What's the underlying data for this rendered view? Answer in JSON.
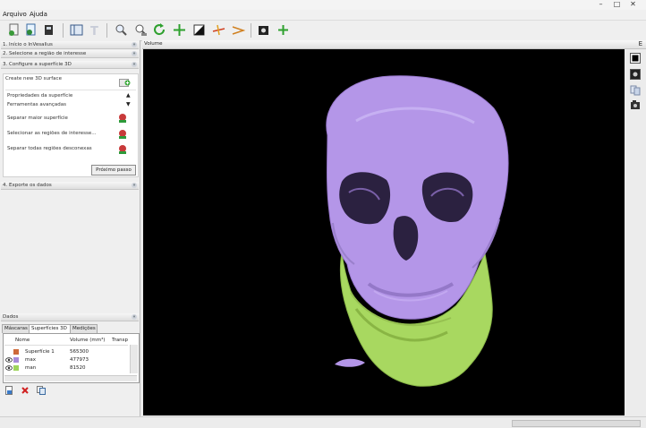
{
  "menu": [
    "Arquivo",
    "Ajuda"
  ],
  "window_controls": [
    "minimize",
    "maximize",
    "close"
  ],
  "toolbar_icons": [
    "import-dicom-icon",
    "import-green-icon",
    "export-icon",
    "layout-icon",
    "text-icon",
    "zoom-icon",
    "zoom-region-icon",
    "rotate-icon",
    "pan-icon",
    "contrast-icon",
    "measure-linear-icon",
    "measure-angle-icon",
    "snapshot-icon",
    "add-icon"
  ],
  "sections": [
    {
      "label": "1. Início o InVesalius"
    },
    {
      "label": "2. Selecione a região de interesse"
    },
    {
      "label": "3. Configure a superfície 3D"
    },
    {
      "label": "4. Exporte os dados"
    }
  ],
  "config": {
    "create_label": "Create new 3D surface",
    "props_label": "Propriedades da superfície",
    "tools_label": "Ferramentas avançadas",
    "op1": "Separar maior superfície",
    "op2": "Selecionar as regiões de interesse...",
    "op3": "Separar todas regiões desconexas",
    "next_button": "Próximo passo"
  },
  "data_panel": {
    "title": "Dados",
    "tabs": [
      "Máscaras",
      "Superfícies 3D",
      "Medições"
    ],
    "active_tab": 1,
    "columns": [
      "Nome",
      "Volume (mm³)",
      "Transp"
    ],
    "rows": [
      {
        "name": "Superfície 1",
        "volume": "565300",
        "color": "#ce6a3a"
      },
      {
        "name": "max",
        "volume": "477973",
        "color": "#a88bd8"
      },
      {
        "name": "man",
        "volume": "81520",
        "color": "#9ed45c"
      }
    ]
  },
  "viewer": {
    "title": "Volume",
    "corner_label": "E",
    "skull_color": "#b496e8",
    "mandible_color": "#a8d860",
    "background": "#000000"
  }
}
